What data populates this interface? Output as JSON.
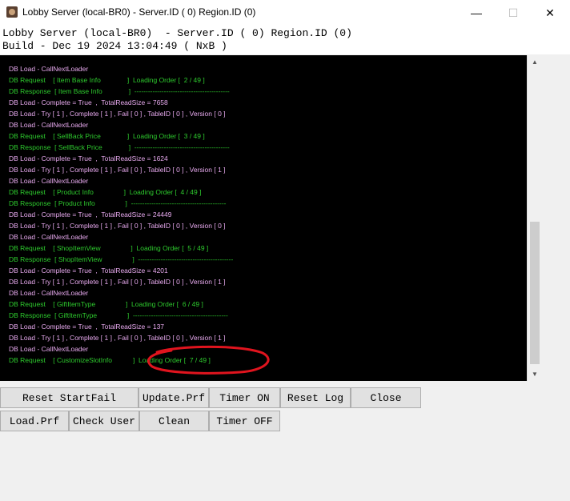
{
  "window": {
    "title": "Lobby Server (local-BR0)  - Server.ID ( 0) Region.ID (0)",
    "minimize_glyph": "—",
    "maximize_glyph": "☐",
    "close_glyph": "✕"
  },
  "header": {
    "line1": "Lobby Server (local-BR0)  - Server.ID ( 0) Region.ID (0)",
    "line2": "Build - Dec 19 2024 13:04:49 ( NxB )"
  },
  "log": [
    {
      "text": "DB Load - CallNextLoader",
      "kind": "load"
    },
    {
      "text": "DB Request    [ Item Base Info              ]  Loading Order [  2 / 49 ]",
      "kind": "req"
    },
    {
      "text": "DB Response  [ Item Base Info              ]  ------------------------------------------",
      "kind": "req"
    },
    {
      "text": "DB Load - Complete = True  ,  TotalReadSize = 7658",
      "kind": "load"
    },
    {
      "text": "DB Load - Try [ 1 ] , Complete [ 1 ] , Fail [ 0 ] , TableID [ 0 ] , Version [ 0 ]",
      "kind": "load"
    },
    {
      "text": "DB Load - CallNextLoader",
      "kind": "load"
    },
    {
      "text": "DB Request    [ SellBack Price              ]  Loading Order [  3 / 49 ]",
      "kind": "req"
    },
    {
      "text": "DB Response  [ SellBack Price              ]  ------------------------------------------",
      "kind": "req"
    },
    {
      "text": "DB Load - Complete = True  ,  TotalReadSize = 1624",
      "kind": "load"
    },
    {
      "text": "DB Load - Try [ 1 ] , Complete [ 1 ] , Fail [ 0 ] , TableID [ 0 ] , Version [ 1 ]",
      "kind": "load"
    },
    {
      "text": "DB Load - CallNextLoader",
      "kind": "load"
    },
    {
      "text": "DB Request    [ Product Info                ]  Loading Order [  4 / 49 ]",
      "kind": "req"
    },
    {
      "text": "DB Response  [ Product Info                ]  ------------------------------------------",
      "kind": "req"
    },
    {
      "text": "DB Load - Complete = True  ,  TotalReadSize = 24449",
      "kind": "load"
    },
    {
      "text": "DB Load - Try [ 1 ] , Complete [ 1 ] , Fail [ 0 ] , TableID [ 0 ] , Version [ 0 ]",
      "kind": "load"
    },
    {
      "text": "DB Load - CallNextLoader",
      "kind": "load"
    },
    {
      "text": "DB Request    [ ShopItemView                ]  Loading Order [  5 / 49 ]",
      "kind": "req"
    },
    {
      "text": "DB Response  [ ShopItemView                ]  ------------------------------------------",
      "kind": "req"
    },
    {
      "text": "DB Load - Complete = True  ,  TotalReadSize = 4201",
      "kind": "load"
    },
    {
      "text": "DB Load - Try [ 1 ] , Complete [ 1 ] , Fail [ 0 ] , TableID [ 0 ] , Version [ 1 ]",
      "kind": "load"
    },
    {
      "text": "DB Load - CallNextLoader",
      "kind": "load"
    },
    {
      "text": "DB Request    [ GiftItemType                ]  Loading Order [  6 / 49 ]",
      "kind": "req"
    },
    {
      "text": "DB Response  [ GiftItemType                ]  ------------------------------------------",
      "kind": "req"
    },
    {
      "text": "DB Load - Complete = True  ,  TotalReadSize = 137",
      "kind": "load"
    },
    {
      "text": "DB Load - Try [ 1 ] , Complete [ 1 ] , Fail [ 0 ] , TableID [ 0 ] , Version [ 1 ]",
      "kind": "load"
    },
    {
      "text": "DB Load - CallNextLoader",
      "kind": "load"
    },
    {
      "text": "DB Request    [ CustomizeSlotInfo           ]  Loading Order [  7 / 49 ]",
      "kind": "req"
    }
  ],
  "colors": {
    "log_load": "#e7a9ee",
    "log_request": "#2ecc2e",
    "log_background": "#000000",
    "annotation": "#e0141e"
  },
  "scrollbar": {
    "up_glyph": "▲",
    "down_glyph": "▼"
  },
  "buttons": {
    "reset_startfail": "Reset StartFail",
    "update_prf": "Update.Prf",
    "timer_on": "Timer ON",
    "reset_log": "Reset Log",
    "close": "Close",
    "load_prf": "Load.Prf",
    "check_user": "Check User",
    "clean": "Clean",
    "timer_off": "Timer OFF"
  }
}
